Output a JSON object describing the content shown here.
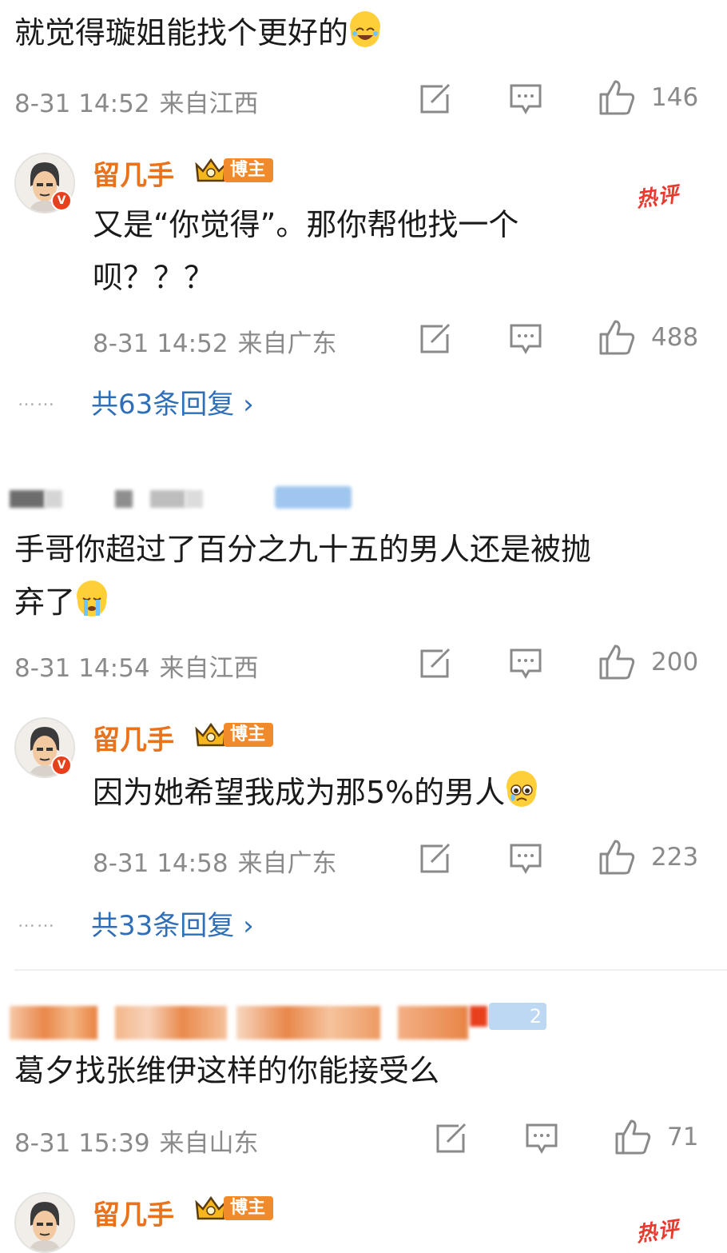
{
  "comment1": {
    "text": "就觉得璇姐能找个更好的",
    "emoji": "laugh-cry-emoji",
    "time": "8-31 14:52",
    "source": "来自江西",
    "likes": "146"
  },
  "reply1": {
    "author": "留几手",
    "badge": "博主",
    "hot": "热评",
    "text_line1": "又是“你觉得”。那你帮他找一个",
    "text_line2": "呗？？？",
    "time": "8-31 14:52",
    "source": "来自广东",
    "likes": "488",
    "replies_dots": "……",
    "replies": "共63条回复 ›"
  },
  "comment2": {
    "text_line1": "手哥你超过了百分之九十五的男人还是被抛",
    "text_line2": "弃了",
    "emoji": "crying-emoji",
    "time": "8-31 14:54",
    "source": "来自江西",
    "likes": "200"
  },
  "reply2": {
    "author": "留几手",
    "badge": "博主",
    "text": "因为她希望我成为那5%的男人",
    "emoji": "teary-emoji",
    "time": "8-31 14:58",
    "source": "来自广东",
    "likes": "223",
    "replies_dots": "……",
    "replies": "共33条回复 ›"
  },
  "comment3": {
    "username_suffix": "2",
    "text": "葛夕找张维伊这样的你能接受么",
    "time": "8-31 15:39",
    "source": "来自山东",
    "likes": "71"
  },
  "reply3": {
    "author": "留几手",
    "badge": "博主",
    "hot": "热评"
  },
  "colors": {
    "author": "#e8731f",
    "link": "#2f6fb7",
    "hot": "#e83a2e",
    "meta": "#8a8a8a"
  }
}
